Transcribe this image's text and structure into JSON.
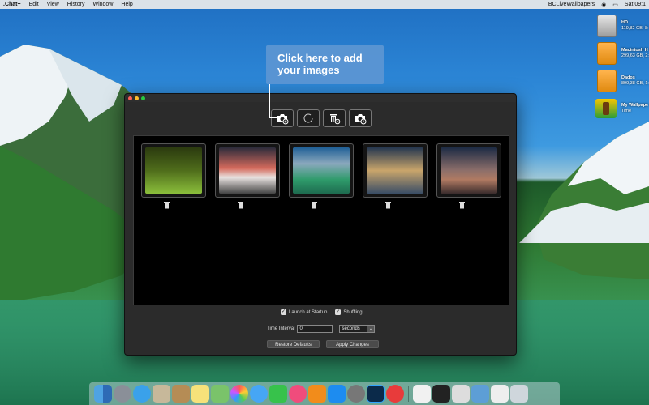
{
  "menubar": {
    "app_name": ".Chat+",
    "items": [
      "Edit",
      "View",
      "History",
      "Window",
      "Help"
    ],
    "right_app_name": "BCLiveWallpapers",
    "clock": "Sat 09:1"
  },
  "desktop_icons": [
    {
      "name": "HD",
      "sub": "119,82 GB, 8:",
      "kind": "drive-gray"
    },
    {
      "name": "Macintosh H",
      "sub": "299,63 GB, 2:",
      "kind": "drive-orange"
    },
    {
      "name": "Dados",
      "sub": "899,38 GB, 1:",
      "kind": "drive-orange"
    },
    {
      "name": "My Wallpape",
      "sub": "Time",
      "kind": "app"
    }
  ],
  "callout": {
    "text": "Click here to add your images"
  },
  "toolbar": {
    "buttons": [
      {
        "icon": "add-photo-icon"
      },
      {
        "icon": "refresh-icon"
      },
      {
        "icon": "delete-all-icon"
      },
      {
        "icon": "photo-settings-icon"
      }
    ]
  },
  "thumbnails": [
    {
      "theme": "forest",
      "colors": [
        "#2b3a0f",
        "#8bbf3b"
      ]
    },
    {
      "theme": "seascape",
      "colors": [
        "#2b2b3a",
        "#d46a5c"
      ]
    },
    {
      "theme": "mountain-lake",
      "colors": [
        "#1f5f96",
        "#2f9b6b"
      ]
    },
    {
      "theme": "cloudy-sky",
      "colors": [
        "#24364f",
        "#c9a56b"
      ]
    },
    {
      "theme": "desert-rocks",
      "colors": [
        "#1c2b44",
        "#b07a62"
      ]
    }
  ],
  "options": {
    "launch_at_startup": {
      "label": "Launch at Startup",
      "checked": true
    },
    "shuffling": {
      "label": "Shuffling",
      "checked": true
    },
    "time_interval": {
      "label": "Time Interval",
      "value": "0"
    },
    "unit_select": {
      "value": "seconds"
    }
  },
  "buttons": {
    "restore_defaults": "Restore Defaults",
    "apply_changes": "Apply Changes"
  },
  "dock": {
    "items": [
      "finder",
      "launchpad",
      "safari",
      "mail-stamp",
      "contacts",
      "notes",
      "maps",
      "photos",
      "messages",
      "facetime",
      "itunes",
      "ibooks",
      "app-store",
      "system-preferences",
      "photoshop",
      "chat",
      "document",
      "screen",
      "calendar",
      "screenshot",
      "mirror",
      "trash"
    ]
  },
  "colors": {
    "window_bg": "#2b2b2b",
    "callout_bg": "#5c96d2"
  }
}
